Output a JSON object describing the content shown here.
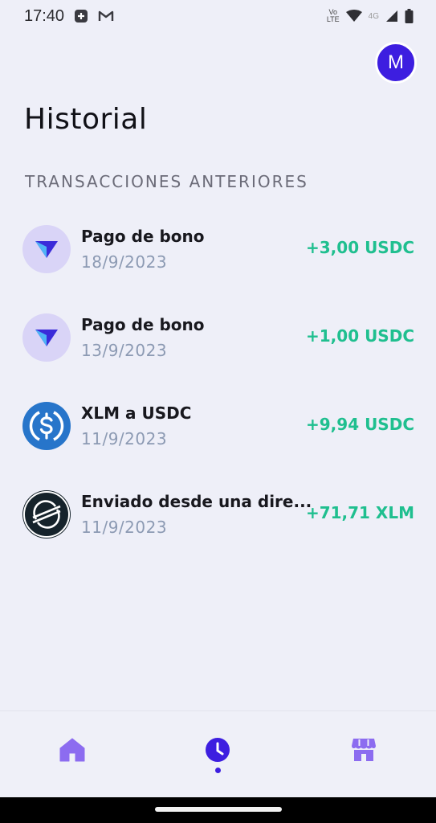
{
  "status_bar": {
    "time": "17:40",
    "left_icons": [
      "notification-plus-icon",
      "gmail-icon"
    ],
    "volte": "Vo\nLTE",
    "network": "4G",
    "right_icons": [
      "volte-icon",
      "wifi-icon",
      "signal-icon",
      "battery-icon"
    ]
  },
  "avatar": {
    "initial": "M",
    "color": "#3d1ee0"
  },
  "page": {
    "title": "Historial",
    "section_label": "TRANSACCIONES ANTERIORES"
  },
  "transactions": [
    {
      "icon": "bonus-arrow-icon",
      "title": "Pago de bono",
      "date": "18/9/2023",
      "amount": "+3,00 USDC"
    },
    {
      "icon": "bonus-arrow-icon",
      "title": "Pago de bono",
      "date": "13/9/2023",
      "amount": "+1,00 USDC"
    },
    {
      "icon": "usdc-coin-icon",
      "title": "XLM a USDC",
      "date": "11/9/2023",
      "amount": "+9,94 USDC"
    },
    {
      "icon": "stellar-xlm-icon",
      "title": "Enviado desde una dire...",
      "date": "11/9/2023",
      "amount": "+71,71 XLM"
    }
  ],
  "colors": {
    "positive": "#1fbf8f",
    "accent": "#3d1ee0",
    "nav_inactive": "#8c6cf0",
    "date": "#8c9ab3"
  },
  "bottom_nav": {
    "items": [
      {
        "icon": "home-icon",
        "active": false
      },
      {
        "icon": "history-clock-icon",
        "active": true
      },
      {
        "icon": "store-icon",
        "active": false
      }
    ]
  }
}
